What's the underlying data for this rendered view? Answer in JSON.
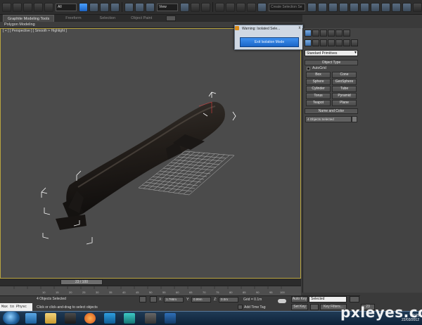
{
  "toolbar": {
    "filter_value": "All",
    "view_value": "View",
    "selection_set_placeholder": "Create Selection Se"
  },
  "ribbon": {
    "tabs": [
      {
        "label": "Graphite Modeling Tools",
        "active": true
      },
      {
        "label": "Freeform",
        "active": false
      },
      {
        "label": "Selection",
        "active": false
      },
      {
        "label": "Object Paint",
        "active": false
      }
    ],
    "panel_label": "Polygon Modeling"
  },
  "viewport": {
    "label": "[ + ] [ Perspective ] [ Smooth + Highlight ]",
    "border_color": "#b8a440"
  },
  "dialog": {
    "title": "Warning: Isolated Sele...",
    "close": "x",
    "button": "Exit Isolation Mode"
  },
  "command_panel": {
    "dropdown": "Standard Primitives",
    "object_type_title": "Object Type",
    "autogrid_label": "AutoGrid",
    "buttons": [
      "Box",
      "Cone",
      "Sphere",
      "GeoSphere",
      "Cylinder",
      "Tube",
      "Torus",
      "Pyramid",
      "Teapot",
      "Plane"
    ],
    "name_color_title": "Name and Color",
    "name_value": "4 Objects Selected"
  },
  "timeline": {
    "position": "23 / 100",
    "ticks": [
      "10",
      "15",
      "20",
      "25",
      "30",
      "35",
      "40",
      "45",
      "50",
      "55",
      "60",
      "65",
      "70",
      "75",
      "80",
      "85",
      "90",
      "95",
      "100"
    ]
  },
  "status": {
    "maxscript": "Max to Physc",
    "selected": "4 Objects Selected",
    "prompt": "Click or click-and-drag to select objects",
    "x_label": "X:",
    "x_value": "1.788m",
    "y_label": "Y:",
    "y_value": "0.99m",
    "z_label": "Z:",
    "z_value": "0.0m",
    "grid": "Grid = 0.1m",
    "add_time_tag": "Add Time Tag",
    "auto_key": "Auto Key",
    "set_key": "Set Key",
    "selected_dd": "Selected",
    "key_filters": "Key Filters...",
    "frame": "23"
  },
  "taskbar": {
    "time": "22:05",
    "date": "22/03/2012"
  },
  "watermark": "pxleyes.com"
}
